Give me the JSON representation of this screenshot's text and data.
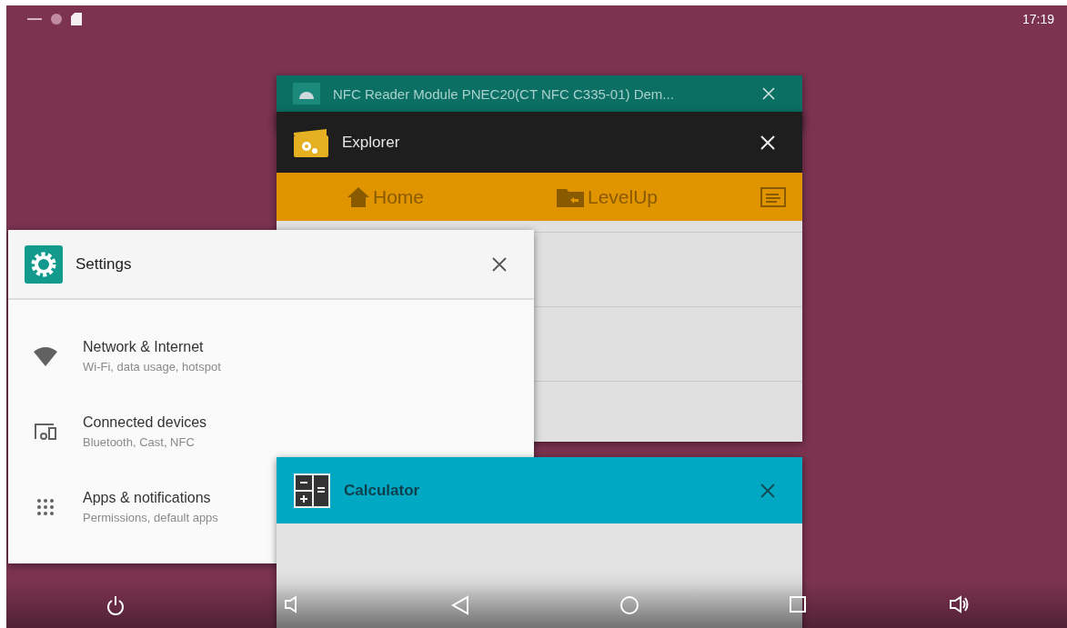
{
  "status_bar": {
    "time": "17:19"
  },
  "recent_apps": [
    {
      "kind": "nfc",
      "title": "NFC Reader Module PNEC20(CT NFC C335-01) Dem..."
    },
    {
      "kind": "explorer",
      "title": "Explorer",
      "toolbar": [
        {
          "kind": "home",
          "label": "Home"
        },
        {
          "kind": "levelup",
          "label": "LevelUp"
        },
        {
          "kind": "menu"
        }
      ]
    },
    {
      "kind": "settings",
      "title": "Settings",
      "items": [
        {
          "kind": "wifi",
          "title": "Network & Internet",
          "subtitle": "Wi-Fi, data usage, hotspot"
        },
        {
          "kind": "devices",
          "title": "Connected devices",
          "subtitle": "Bluetooth, Cast, NFC"
        },
        {
          "kind": "apps",
          "title": "Apps & notifications",
          "subtitle": "Permissions, default apps"
        }
      ]
    },
    {
      "kind": "calculator",
      "title": "Calculator"
    }
  ]
}
